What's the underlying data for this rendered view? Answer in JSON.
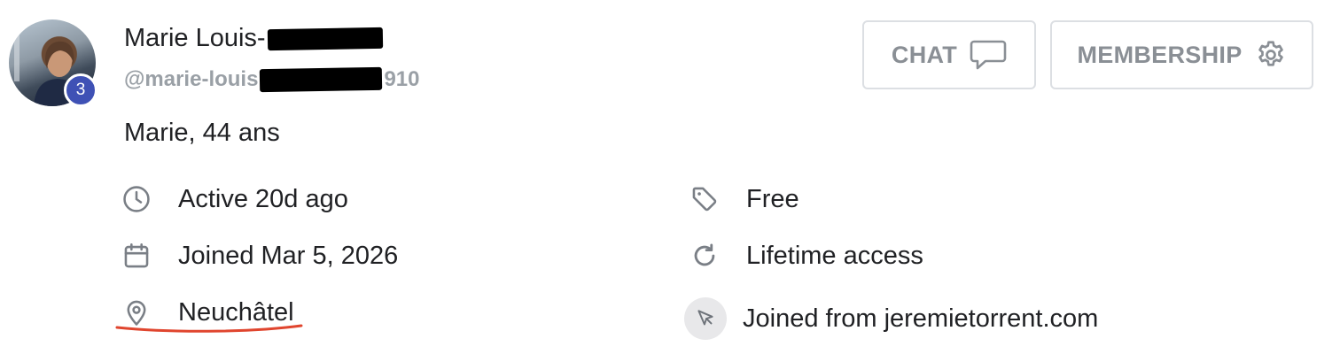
{
  "profile": {
    "name_prefix": "Marie Louis-",
    "handle_prefix": "@marie-louis",
    "handle_suffix": "910",
    "subtitle": "Marie, 44 ans",
    "badge_count": "3"
  },
  "actions": {
    "chat_label": "CHAT",
    "membership_label": "MEMBERSHIP"
  },
  "details": {
    "activity": "Active 20d ago",
    "joined_date": "Joined Mar 5, 2026",
    "location": "Neuchâtel",
    "plan": "Free",
    "access": "Lifetime access",
    "referral": "Joined from jeremietorrent.com"
  },
  "icons": {
    "activity": "clock-icon",
    "joined_date": "calendar-icon",
    "location": "location-pin-icon",
    "plan": "tag-icon",
    "access": "refresh-icon",
    "referral": "cursor-icon",
    "chat": "speech-bubble-icon",
    "membership": "gear-icon"
  },
  "colors": {
    "badge": "#3f51b5",
    "icon": "#7a7f86",
    "button_text": "#8a8f95",
    "annotation": "#e0452e"
  }
}
